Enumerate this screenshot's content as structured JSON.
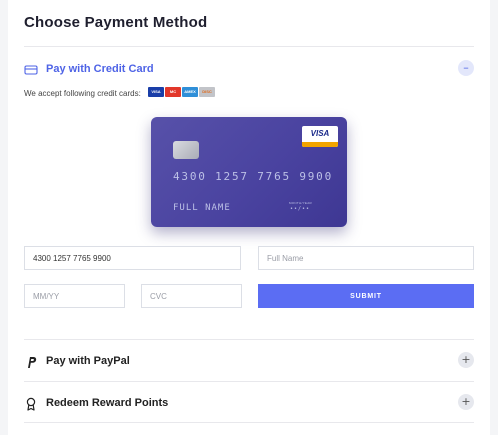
{
  "title": "Choose Payment Method",
  "credit_card": {
    "label": "Pay with Credit Card",
    "toggle": "–",
    "accept_text": "We accept following credit cards:",
    "logos": [
      {
        "name": "visa-logo",
        "text": "VISA",
        "color": "#1a3ea8"
      },
      {
        "name": "mastercard-logo",
        "text": "MC",
        "color": "#e2372a"
      },
      {
        "name": "amex-logo",
        "text": "AMEX",
        "color": "#2f8fd8"
      },
      {
        "name": "discover-logo",
        "text": "DISC",
        "color": "#c2c4c9"
      }
    ],
    "card": {
      "brand": "VISA",
      "number": "4300 1257 7765 9900",
      "name": "FULL NAME",
      "valid_label": "MONTH/YEAR",
      "expiry": "••/••"
    },
    "form": {
      "number_value": "4300 1257 7765 9900",
      "name_placeholder": "Full Name",
      "expiry_placeholder": "MM/YY",
      "cvc_placeholder": "CVC",
      "submit_label": "SUBMIT"
    }
  },
  "paypal": {
    "label": "Pay with PayPal",
    "toggle": "+"
  },
  "reward": {
    "label": "Redeem Reward Points",
    "toggle": "+"
  },
  "colors": {
    "accent": "#4e63e6",
    "button": "#5b6df3",
    "card": "#4a43a0"
  }
}
